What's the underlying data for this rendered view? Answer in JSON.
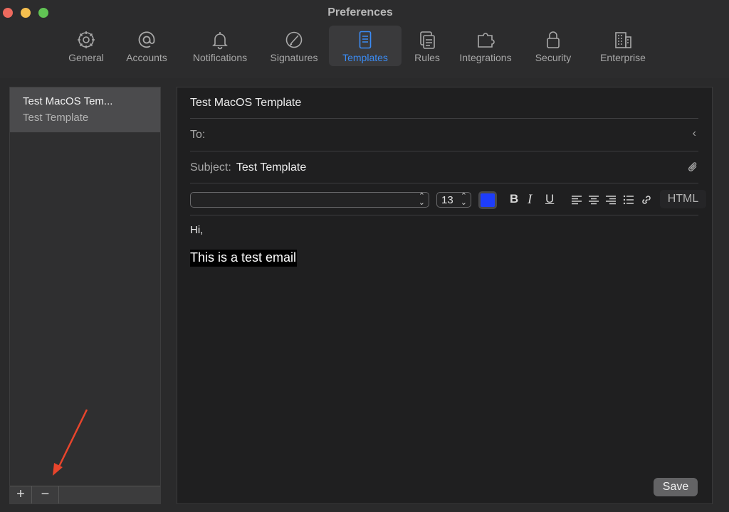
{
  "window": {
    "title": "Preferences"
  },
  "toolbar": {
    "items": [
      {
        "label": "General",
        "icon": "gear-icon"
      },
      {
        "label": "Accounts",
        "icon": "at-icon"
      },
      {
        "label": "Notifications",
        "icon": "bell-icon"
      },
      {
        "label": "Signatures",
        "icon": "signature-icon"
      },
      {
        "label": "Templates",
        "icon": "template-icon",
        "active": true
      },
      {
        "label": "Rules",
        "icon": "rules-icon"
      },
      {
        "label": "Integrations",
        "icon": "puzzle-icon"
      },
      {
        "label": "Security",
        "icon": "lock-icon"
      },
      {
        "label": "Enterprise",
        "icon": "building-icon"
      }
    ]
  },
  "sidebar": {
    "templates": [
      {
        "title": "Test MacOS Tem...",
        "subtitle": "Test Template"
      }
    ],
    "add_label": "+",
    "remove_label": "−"
  },
  "editor": {
    "template_name": "Test MacOS Template",
    "to_label": "To:",
    "subject_label": "Subject:",
    "subject_value": "Test Template",
    "font_size": "13",
    "text_color": "#1e3dfa",
    "bold_label": "B",
    "italic_label": "I",
    "underline_label": "U",
    "html_label": "HTML",
    "body_line1": "Hi,",
    "body_line2": "This is a test email",
    "save_label": "Save"
  },
  "colors": {
    "accent": "#3b8cf5",
    "arrow": "#e8452c"
  }
}
